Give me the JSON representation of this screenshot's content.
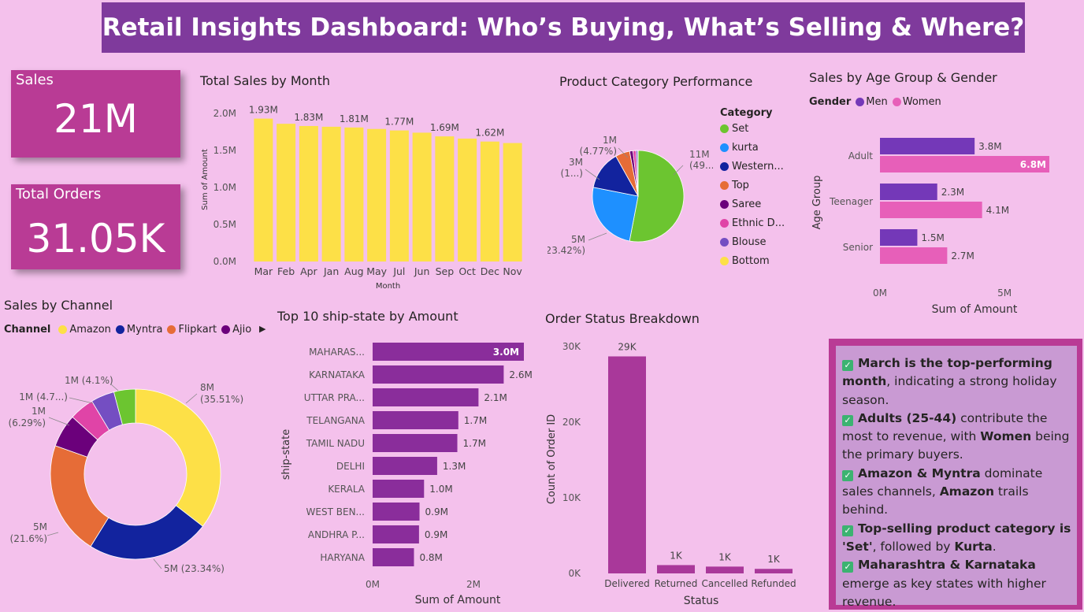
{
  "header": {
    "title": "Retail Insights Dashboard: Who’s Buying, What’s Selling & Where?"
  },
  "kpis": {
    "sales": {
      "label": "Sales",
      "value": "21M"
    },
    "orders": {
      "label": "Total Orders",
      "value": "31.05K"
    }
  },
  "insights": [
    {
      "parts": [
        {
          "t": "March is the top-performing month",
          "b": true
        },
        {
          "t": ", indicating a strong holiday season.",
          "b": false
        }
      ]
    },
    {
      "parts": [
        {
          "t": "Adults (25-44)",
          "b": true
        },
        {
          "t": " contribute the most to revenue, with ",
          "b": false
        },
        {
          "t": "Women",
          "b": true
        },
        {
          "t": " being the primary buyers.",
          "b": false
        }
      ]
    },
    {
      "parts": [
        {
          "t": "Amazon & Myntra",
          "b": true
        },
        {
          "t": " dominate sales channels, ",
          "b": false
        },
        {
          "t": "Amazon",
          "b": true
        },
        {
          "t": " trails behind.",
          "b": false
        }
      ]
    },
    {
      "parts": [
        {
          "t": "Top-selling product category is 'Set'",
          "b": true
        },
        {
          "t": ", followed by ",
          "b": false
        },
        {
          "t": "Kurta",
          "b": true
        },
        {
          "t": ".",
          "b": false
        }
      ]
    },
    {
      "parts": [
        {
          "t": "Maharashtra & Karnataka",
          "b": true
        },
        {
          "t": " emerge as key states with higher revenue.",
          "b": false
        }
      ]
    }
  ],
  "chart_data": [
    {
      "id": "monthly",
      "type": "bar",
      "title": "Total Sales by Month",
      "xlabel": "Month",
      "ylabel": "Sum of Amount",
      "ylim": [
        0,
        2000000
      ],
      "yticks": [
        "0.0M",
        "0.5M",
        "1.0M",
        "1.5M",
        "2.0M"
      ],
      "categories": [
        "Mar",
        "Feb",
        "Apr",
        "Jan",
        "Aug",
        "May",
        "Jul",
        "Jun",
        "Sep",
        "Oct",
        "Dec",
        "Nov"
      ],
      "values": [
        1930000,
        1860000,
        1830000,
        1820000,
        1810000,
        1790000,
        1770000,
        1740000,
        1690000,
        1660000,
        1620000,
        1600000
      ],
      "data_labels": [
        "1.93M",
        "",
        "1.83M",
        "",
        "1.81M",
        "",
        "1.77M",
        "",
        "1.69M",
        "",
        "1.62M",
        ""
      ],
      "color": "#fde047",
      "grid": false
    },
    {
      "id": "category",
      "type": "pie",
      "title": "Product Category Performance",
      "legend_title": "Category",
      "legend_position": "right",
      "categories": [
        "Set",
        "kurta",
        "Western...",
        "Top",
        "Saree",
        "Ethnic D...",
        "Blouse",
        "Bottom"
      ],
      "values": [
        49.5,
        23.42,
        12.9,
        4.77,
        1.1,
        0.99,
        0.6,
        0.1
      ],
      "colors": [
        "#6cc530",
        "#1e90ff",
        "#12239e",
        "#e66c37",
        "#6b007b",
        "#e044a7",
        "#744ec2",
        "#fde047"
      ],
      "data_labels": [
        [
          "11M",
          "(49....)"
        ],
        [
          "5M",
          "(23.42%)"
        ],
        [
          "3M",
          "(1...)"
        ],
        [
          "1M",
          "(4.77%)"
        ],
        [],
        [],
        [],
        []
      ]
    },
    {
      "id": "agegender",
      "type": "bar",
      "orientation": "horizontal",
      "title": "Sales by Age Group & Gender",
      "legend_title": "Gender",
      "legend_position": "top-left",
      "xlabel": "Sum of Amount",
      "ylabel": "Age Group",
      "xlim": [
        0,
        7000000
      ],
      "xticks": [
        "0M",
        "5M"
      ],
      "categories": [
        "Adult",
        "Teenager",
        "Senior"
      ],
      "series": [
        {
          "name": "Men",
          "color": "#7438b8",
          "values": [
            3800000,
            2300000,
            1500000
          ],
          "labels": [
            "3.8M",
            "2.3M",
            "1.5M"
          ]
        },
        {
          "name": "Women",
          "color": "#e75fb9",
          "values": [
            6800000,
            4100000,
            2700000
          ],
          "labels": [
            "6.8M",
            "4.1M",
            "2.7M"
          ]
        }
      ]
    },
    {
      "id": "channel",
      "type": "pie",
      "variant": "donut",
      "title": "Sales by Channel",
      "legend_title": "Channel",
      "legend_position": "top-left",
      "legend_entries": [
        "Amazon",
        "Myntra",
        "Flipkart",
        "Ajio"
      ],
      "categories": [
        "Amazon",
        "Myntra",
        "Flipkart",
        "Ajio",
        "",
        "",
        ""
      ],
      "values": [
        35.51,
        23.34,
        21.6,
        6.29,
        4.7,
        4.48,
        4.1
      ],
      "colors": [
        "#fde047",
        "#12239e",
        "#e66c37",
        "#6b007b",
        "#e044a7",
        "#744ec2",
        "#6cc530"
      ],
      "data_labels": [
        [
          "8M",
          "(35.51%)"
        ],
        [
          "5M (23.34%)"
        ],
        [
          "5M",
          "(21.6%)"
        ],
        [
          "1M",
          "(6.29%)"
        ],
        [
          "1M (4.7...)"
        ],
        [],
        [
          "1M (4.1%)"
        ]
      ]
    },
    {
      "id": "states",
      "type": "bar",
      "orientation": "horizontal",
      "title": "Top 10 ship-state by Amount",
      "xlabel": "Sum of Amount",
      "ylabel": "ship-state",
      "xlim": [
        0,
        3000000
      ],
      "xticks": [
        "0M",
        "2M"
      ],
      "categories": [
        "MAHARAS...",
        "KARNATAKA",
        "UTTAR PRA...",
        "TELANGANA",
        "TAMIL NADU",
        "DELHI",
        "KERALA",
        "WEST BEN...",
        "ANDHRA P...",
        "HARYANA"
      ],
      "values": [
        3000000,
        2600000,
        2100000,
        1700000,
        1680000,
        1280000,
        1020000,
        930000,
        920000,
        820000
      ],
      "data_labels": [
        "3.0M",
        "2.6M",
        "2.1M",
        "1.7M",
        "1.7M",
        "1.3M",
        "1.0M",
        "0.9M",
        "0.9M",
        "0.8M"
      ],
      "color": "#8a2d9b"
    },
    {
      "id": "status",
      "type": "bar",
      "title": "Order Status Breakdown",
      "xlabel": "Status",
      "ylabel": "Count of Order ID",
      "ylim": [
        0,
        30000
      ],
      "yticks": [
        "0K",
        "10K",
        "20K",
        "30K"
      ],
      "categories": [
        "Delivered",
        "Returned",
        "Cancelled",
        "Refunded"
      ],
      "values": [
        28700,
        1100,
        900,
        600
      ],
      "data_labels": [
        "29K",
        "1K",
        "1K",
        "1K"
      ],
      "color": "#a9389a"
    }
  ]
}
